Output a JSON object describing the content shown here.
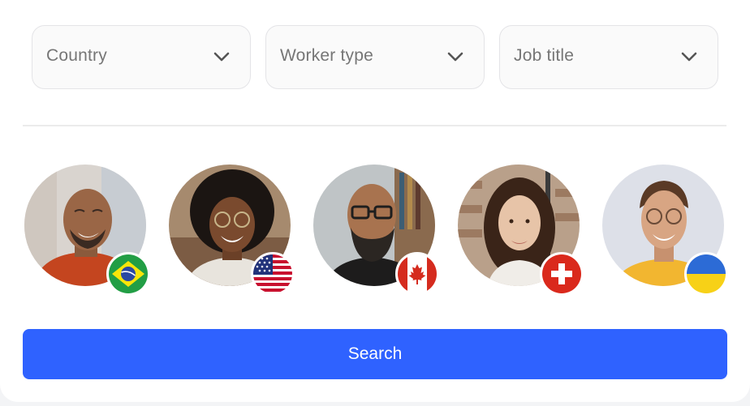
{
  "filters": [
    {
      "label": "Country",
      "icon": "chevron-down-icon"
    },
    {
      "label": "Worker type",
      "icon": "chevron-down-icon"
    },
    {
      "label": "Job title",
      "icon": "chevron-down-icon"
    }
  ],
  "workers": [
    {
      "flag": "brazil-flag-icon"
    },
    {
      "flag": "united-states-flag-icon"
    },
    {
      "flag": "canada-flag-icon"
    },
    {
      "flag": "switzerland-flag-icon"
    },
    {
      "flag": "ukraine-flag-icon"
    }
  ],
  "search_button": {
    "label": "Search"
  },
  "colors": {
    "accent": "#2f62ff",
    "border": "#e4e4e7",
    "placeholder": "#767676"
  }
}
